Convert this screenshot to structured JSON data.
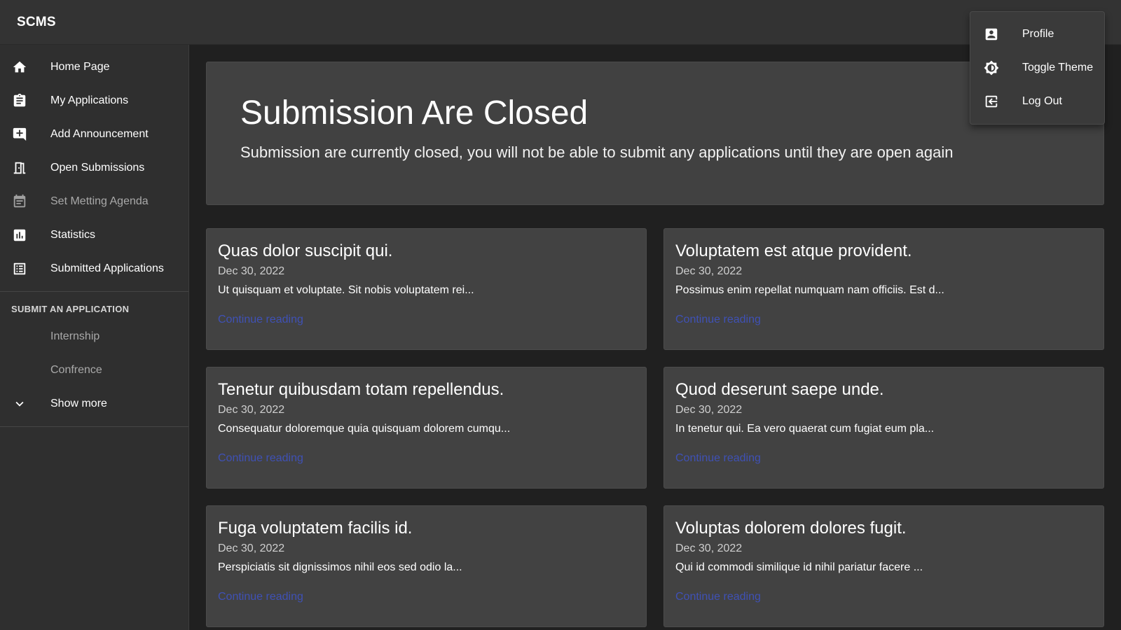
{
  "app": {
    "title": "SCMS"
  },
  "sidebar": {
    "items": [
      {
        "label": "Home Page",
        "icon": "home-icon"
      },
      {
        "label": "My Applications",
        "icon": "clipboard-icon"
      },
      {
        "label": "Add Announcement",
        "icon": "add-comment-icon"
      },
      {
        "label": "Open Submissions",
        "icon": "door-open-icon"
      },
      {
        "label": "Set Metting Agenda",
        "icon": "calendar-icon",
        "disabled": true
      },
      {
        "label": "Statistics",
        "icon": "bar-chart-icon"
      },
      {
        "label": "Submitted Applications",
        "icon": "list-icon"
      }
    ],
    "section_header": "SUBMIT AN APPLICATION",
    "sub_items": [
      {
        "label": "Internship"
      },
      {
        "label": "Confrence"
      }
    ],
    "show_more": {
      "label": "Show more",
      "icon": "chevron-down-icon"
    }
  },
  "hero": {
    "title": "Submission Are Closed",
    "subtitle": "Submission are currently closed, you will not be able to submit any applications until they are open again"
  },
  "announcements": [
    {
      "title": "Quas dolor suscipit qui.",
      "date": "Dec 30, 2022",
      "excerpt": "Ut quisquam et voluptate. Sit nobis voluptatem rei...",
      "link": "Continue reading"
    },
    {
      "title": "Voluptatem est atque provident.",
      "date": "Dec 30, 2022",
      "excerpt": "Possimus enim repellat numquam nam officiis. Est d...",
      "link": "Continue reading"
    },
    {
      "title": "Tenetur quibusdam totam repellendus.",
      "date": "Dec 30, 2022",
      "excerpt": "Consequatur doloremque quia quisquam dolorem cumqu...",
      "link": "Continue reading"
    },
    {
      "title": "Quod deserunt saepe unde.",
      "date": "Dec 30, 2022",
      "excerpt": "In tenetur qui. Ea vero quaerat cum fugiat eum pla...",
      "link": "Continue reading"
    },
    {
      "title": "Fuga voluptatem facilis id.",
      "date": "Dec 30, 2022",
      "excerpt": "Perspiciatis sit dignissimos nihil eos sed odio la...",
      "link": "Continue reading"
    },
    {
      "title": "Voluptas dolorem dolores fugit.",
      "date": "Dec 30, 2022",
      "excerpt": "Qui id commodi similique id nihil pariatur facere ...",
      "link": "Continue reading"
    }
  ],
  "user_menu": {
    "items": [
      {
        "label": "Profile",
        "icon": "account-box-icon"
      },
      {
        "label": "Toggle Theme",
        "icon": "brightness-icon"
      },
      {
        "label": "Log Out",
        "icon": "logout-icon"
      }
    ]
  },
  "colors": {
    "background": "#202020",
    "appbar": "#333333",
    "sidebar": "#2f2f2f",
    "card": "#424242",
    "link": "#3f51b5"
  }
}
